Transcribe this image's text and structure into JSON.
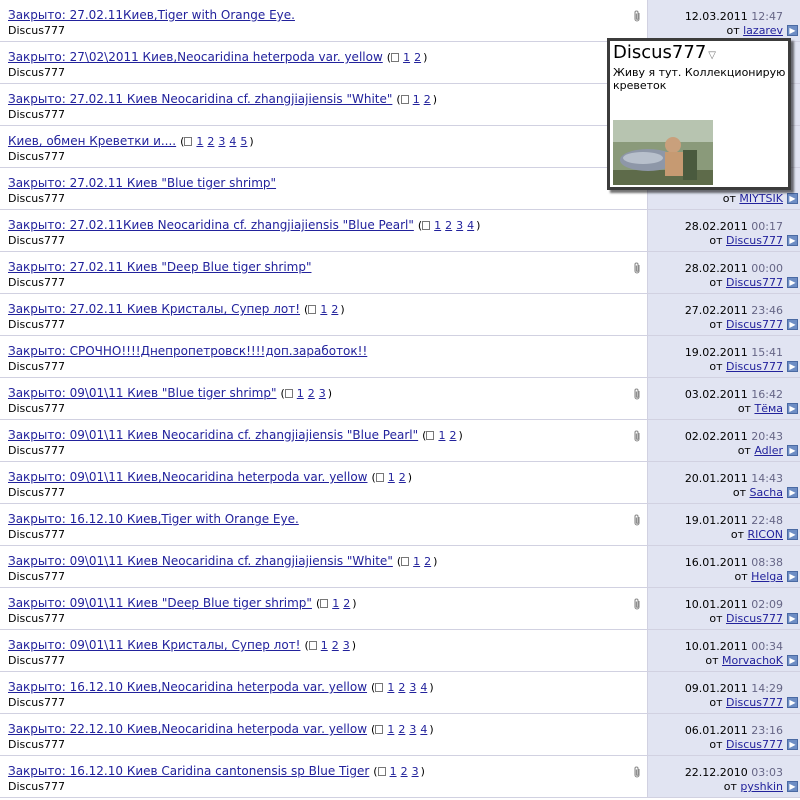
{
  "threads": [
    {
      "title": "Закрыто:  27.02.11Киев,Tiger with Orange Eye.",
      "pages": [],
      "author": "Discus777",
      "attachment": true,
      "date": "12.03.2011",
      "time": "12:47",
      "by_prefix": "от",
      "last_poster": "lazarev"
    },
    {
      "title": "Закрыто:  27\\02\\2011 Киев,Neocaridina heterpoda var. yellow",
      "pages": [
        "1",
        "2"
      ],
      "author": "Discus777",
      "attachment": false,
      "date": "",
      "time": "",
      "by_prefix": "",
      "last_poster": ""
    },
    {
      "title": "Закрыто:  27.02.11 Киев Neocaridina cf. zhangjiajiensis \"White\"",
      "pages": [
        "1",
        "2"
      ],
      "author": "Discus777",
      "attachment": false,
      "date": "",
      "time": "",
      "by_prefix": "",
      "last_poster": ""
    },
    {
      "title": "Киев, обмен Креветки и....",
      "pages": [
        "1",
        "2",
        "3",
        "4",
        "5"
      ],
      "author": "Discus777",
      "attachment": false,
      "date": "",
      "time": "",
      "by_prefix": "",
      "last_poster": ""
    },
    {
      "title": "Закрыто:  27.02.11 Киев \"Blue tiger shrimp\"",
      "pages": [],
      "author": "Discus777",
      "attachment": false,
      "date": "",
      "time": "",
      "by_prefix": "от",
      "last_poster": "MIYTSIK"
    },
    {
      "title": "Закрыто:  27.02.11Киев Neocaridina cf. zhangjiajiensis \"Blue Pearl\"",
      "pages": [
        "1",
        "2",
        "3",
        "4"
      ],
      "author": "Discus777",
      "attachment": false,
      "date": "28.02.2011",
      "time": "00:17",
      "by_prefix": "от",
      "last_poster": "Discus777"
    },
    {
      "title": "Закрыто:  27.02.11 Киев \"Deep Blue tiger shrimp\"",
      "pages": [],
      "author": "Discus777",
      "attachment": true,
      "date": "28.02.2011",
      "time": "00:00",
      "by_prefix": "от",
      "last_poster": "Discus777"
    },
    {
      "title": "Закрыто:  27.02.11 Киев Кристалы, Супер лот!",
      "pages": [
        "1",
        "2"
      ],
      "author": "Discus777",
      "attachment": false,
      "date": "27.02.2011",
      "time": "23:46",
      "by_prefix": "от",
      "last_poster": "Discus777"
    },
    {
      "title": "Закрыто:  СРОЧНО!!!!Днепропетровск!!!!доп.заработок!!",
      "pages": [],
      "author": "Discus777",
      "attachment": false,
      "date": "19.02.2011",
      "time": "15:41",
      "by_prefix": "от",
      "last_poster": "Discus777"
    },
    {
      "title": "Закрыто:  09\\01\\11 Киев \"Blue tiger shrimp\"",
      "pages": [
        "1",
        "2",
        "3"
      ],
      "author": "Discus777",
      "attachment": true,
      "date": "03.02.2011",
      "time": "16:42",
      "by_prefix": "от",
      "last_poster": "Тёма"
    },
    {
      "title": "Закрыто:  09\\01\\11 Киев Neocaridina cf. zhangjiajiensis \"Blue Pearl\"",
      "pages": [
        "1",
        "2"
      ],
      "author": "Discus777",
      "attachment": true,
      "date": "02.02.2011",
      "time": "20:43",
      "by_prefix": "от",
      "last_poster": "Adler"
    },
    {
      "title": "Закрыто:  09\\01\\11 Киев,Neocaridina heterpoda var. yellow",
      "pages": [
        "1",
        "2"
      ],
      "author": "Discus777",
      "attachment": false,
      "date": "20.01.2011",
      "time": "14:43",
      "by_prefix": "от",
      "last_poster": "Sacha"
    },
    {
      "title": "Закрыто:  16.12.10 Киев,Tiger with Orange Eye.",
      "pages": [],
      "author": "Discus777",
      "attachment": true,
      "date": "19.01.2011",
      "time": "22:48",
      "by_prefix": "от",
      "last_poster": "RICON"
    },
    {
      "title": "Закрыто:  09\\01\\11 Киев Neocaridina cf. zhangjiajiensis \"White\"",
      "pages": [
        "1",
        "2"
      ],
      "author": "Discus777",
      "attachment": false,
      "date": "16.01.2011",
      "time": "08:38",
      "by_prefix": "от",
      "last_poster": "Helga"
    },
    {
      "title": "Закрыто:  09\\01\\11 Киев \"Deep Blue tiger shrimp\"",
      "pages": [
        "1",
        "2"
      ],
      "author": "Discus777",
      "attachment": true,
      "date": "10.01.2011",
      "time": "02:09",
      "by_prefix": "от",
      "last_poster": "Discus777"
    },
    {
      "title": "Закрыто:  09\\01\\11 Киев Кристалы, Супер лот!",
      "pages": [
        "1",
        "2",
        "3"
      ],
      "author": "Discus777",
      "attachment": false,
      "date": "10.01.2011",
      "time": "00:34",
      "by_prefix": "от",
      "last_poster": "MorvachoK"
    },
    {
      "title": "Закрыто:  16.12.10 Киев,Neocaridina heterpoda var. yellow",
      "pages": [
        "1",
        "2",
        "3",
        "4"
      ],
      "author": "Discus777",
      "attachment": false,
      "date": "09.01.2011",
      "time": "14:29",
      "by_prefix": "от",
      "last_poster": "Discus777"
    },
    {
      "title": "Закрыто:  22.12.10 Киев,Neocaridina heterpoda var. yellow",
      "pages": [
        "1",
        "2",
        "3",
        "4"
      ],
      "author": "Discus777",
      "attachment": false,
      "date": "06.01.2011",
      "time": "23:16",
      "by_prefix": "от",
      "last_poster": "Discus777"
    },
    {
      "title": "Закрыто:  16.12.10 Киев Caridina cantonensis sp Blue Tiger",
      "pages": [
        "1",
        "2",
        "3"
      ],
      "author": "Discus777",
      "attachment": true,
      "date": "22.12.2010",
      "time": "03:03",
      "by_prefix": "от",
      "last_poster": "pyshkin"
    }
  ],
  "profile_popup": {
    "username": "Discus777",
    "about": "Живу я тут. Коллекционирую креветок"
  },
  "colors": {
    "link": "#22229c",
    "row_meta_bg": "#e1e4f2",
    "divider": "#d1d1e1",
    "time": "#666686"
  },
  "icons": {
    "attachment": "paperclip-icon",
    "pages": "multipage-icon",
    "go_last_post": "arrow-right-icon",
    "popup_menu": "caret-down-icon"
  }
}
